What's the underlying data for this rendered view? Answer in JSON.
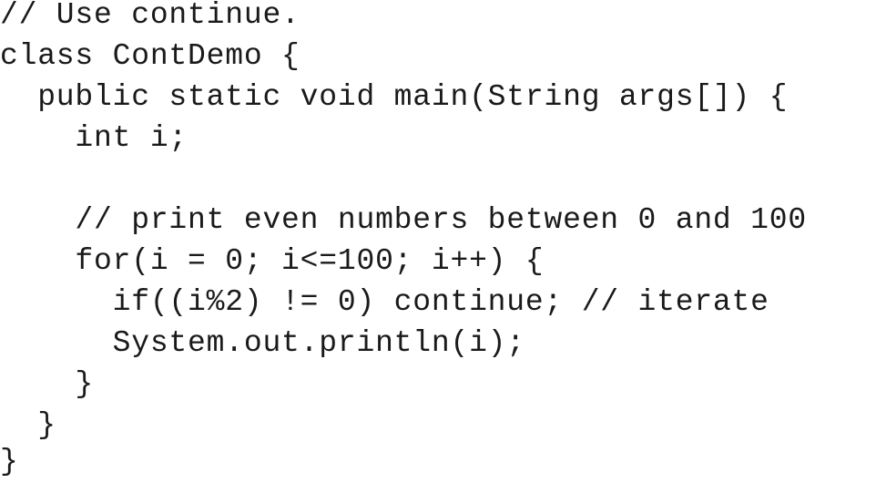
{
  "code": {
    "lines": [
      "// Use continue.",
      "class ContDemo {",
      "  public static void main(String args[]) {",
      "    int i;",
      "",
      "    // print even numbers between 0 and 100",
      "    for(i = 0; i<=100; i++) {",
      "      if((i%2) != 0) continue; // iterate",
      "      System.out.println(i);",
      "    }",
      "  }",
      "}"
    ]
  }
}
